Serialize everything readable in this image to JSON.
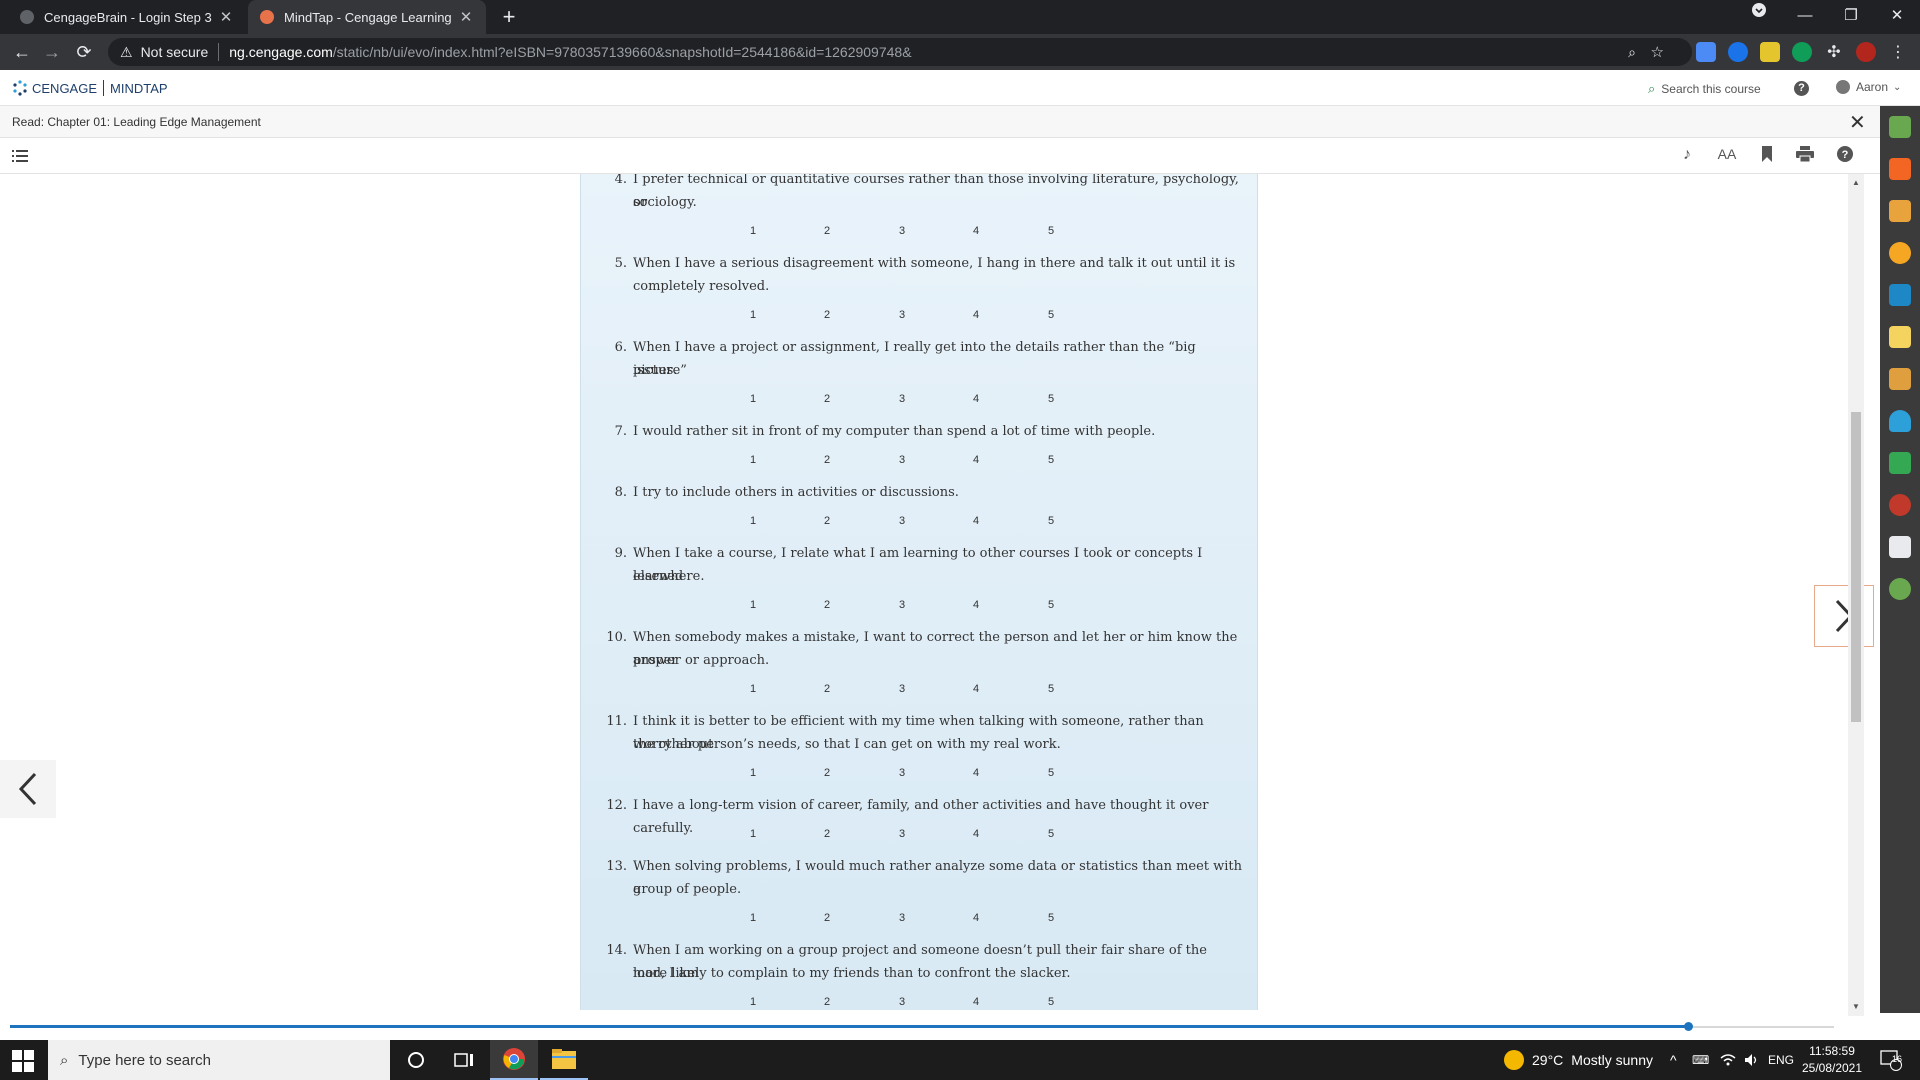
{
  "browser": {
    "tabs": [
      {
        "title": "CengageBrain - Login Step 3",
        "active": false
      },
      {
        "title": "MindTap - Cengage Learning",
        "active": true
      }
    ],
    "new_tab": "+",
    "window_controls": [
      "—",
      "❐",
      "✕"
    ],
    "security_label": "Not secure",
    "url_host": "ng.cengage.com",
    "url_path": "/static/nb/ui/evo/index.html?eISBN=9780357139660&snapshotId=2544186&id=1262909748&"
  },
  "header": {
    "brand_left": "CENGAGE",
    "brand_right": "MINDTAP",
    "search_placeholder": "Search this course",
    "user_name": "Aaron"
  },
  "reader": {
    "title": "Read: Chapter 01: Leading Edge Management",
    "close": "✕",
    "tools": [
      "speech-icon",
      "font-size-icon",
      "bookmark-icon",
      "print-icon",
      "help-icon"
    ],
    "font_size_label": "AA"
  },
  "scale_labels": [
    "1",
    "2",
    "3",
    "4",
    "5"
  ],
  "questions": [
    {
      "num": "4.",
      "lines": [
        "I prefer technical or quantitative courses rather than those involving literature, psychology, or",
        "sociology."
      ]
    },
    {
      "num": "5.",
      "lines": [
        "When I have a serious disagreement with someone, I hang in there and talk it out until it is",
        "completely resolved."
      ]
    },
    {
      "num": "6.",
      "lines": [
        "When I have a project or assignment, I really get into the details rather than the “big picture”",
        "issues."
      ]
    },
    {
      "num": "7.",
      "lines": [
        "I would rather sit in front of my computer than spend a lot of time with people."
      ]
    },
    {
      "num": "8.",
      "lines": [
        "I try to include others in activities or discussions."
      ]
    },
    {
      "num": "9.",
      "lines": [
        "When I take a course, I relate what I am learning to other courses I took or concepts I learned",
        "elsewhere."
      ]
    },
    {
      "num": "10.",
      "lines": [
        "When somebody makes a mistake, I want to correct the person and let her or him know the proper",
        "answer or approach."
      ]
    },
    {
      "num": "11.",
      "lines": [
        "I think it is better to be efficient with my time when talking with someone, rather than worry about",
        "the other person’s needs, so that I can get on with my real work."
      ]
    },
    {
      "num": "12.",
      "lines": [
        "I have a long-term vision of career, family, and other activities and have thought it over carefully."
      ]
    },
    {
      "num": "13.",
      "lines": [
        "When solving problems, I would much rather analyze some data or statistics than meet with a",
        "group of people."
      ]
    },
    {
      "num": "14.",
      "lines": [
        "When I am working on a group project and someone doesn’t pull their fair share of the load, I am",
        "more likely to complain to my friends than to confront the slacker."
      ]
    }
  ],
  "reading_progress": 0.92,
  "taskbar": {
    "search_placeholder": "Type here to search",
    "weather_temp": "29°C",
    "weather_text": "Mostly sunny",
    "language": "ENG",
    "time": "11:58:59",
    "date": "25/08/2021",
    "notification_count": "16"
  },
  "colors": {
    "accent": "#1e73be",
    "panel": "#e3eff8",
    "brand": "#1e3f6b"
  }
}
